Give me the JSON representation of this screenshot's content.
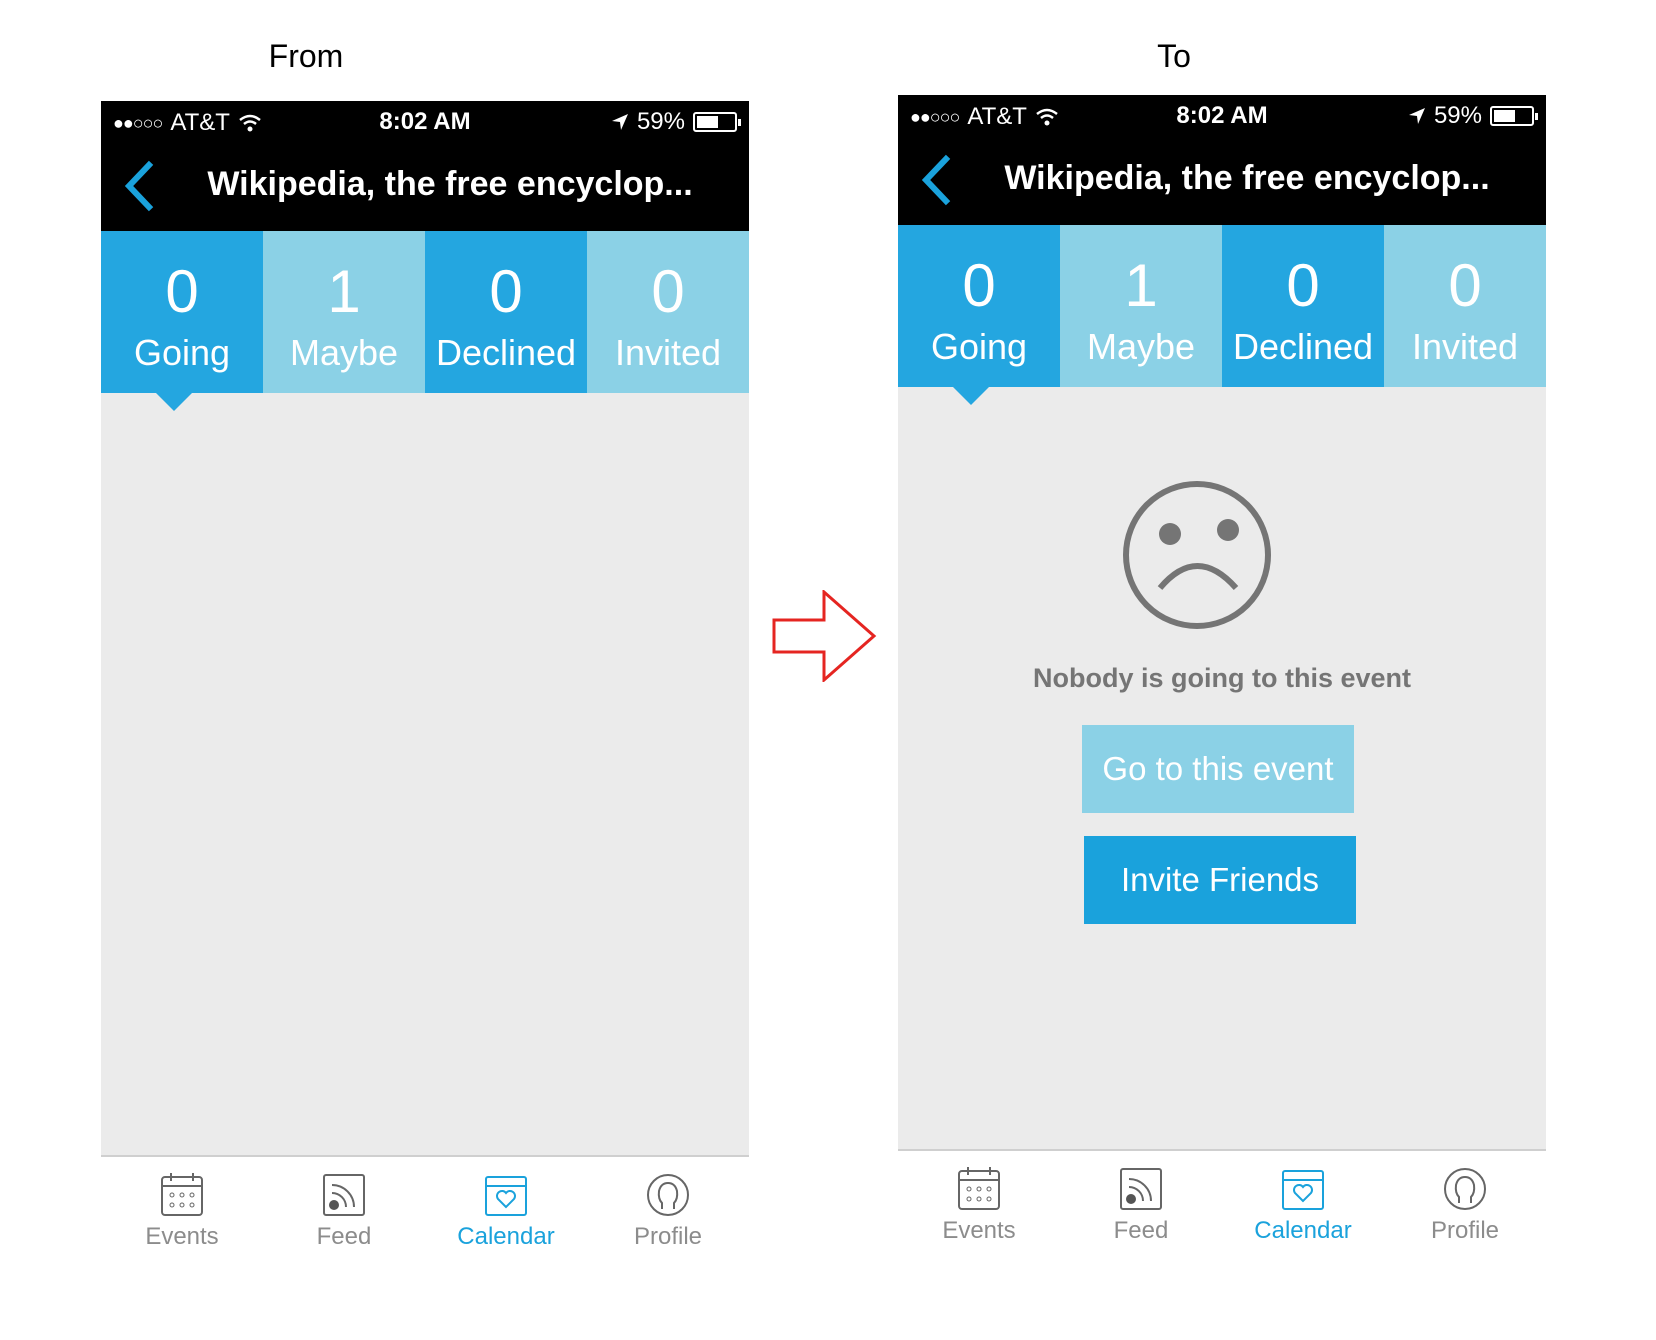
{
  "captions": {
    "from": "From",
    "to": "To"
  },
  "status": {
    "carrier": "AT&T",
    "time": "8:02 AM",
    "battery": "59%",
    "battery_level": 0.59
  },
  "navbar": {
    "title": "Wikipedia, the free encyclop..."
  },
  "tabs": [
    {
      "count": "0",
      "label": "Going",
      "style": "dark"
    },
    {
      "count": "1",
      "label": "Maybe",
      "style": "light"
    },
    {
      "count": "0",
      "label": "Declined",
      "style": "dark"
    },
    {
      "count": "0",
      "label": "Invited",
      "style": "light"
    }
  ],
  "empty_state": {
    "message": "Nobody is going to this event",
    "go_button": "Go to this event",
    "invite_button": "Invite Friends"
  },
  "tabbar": [
    {
      "label": "Events",
      "icon": "calendar-grid-icon",
      "active": false
    },
    {
      "label": "Feed",
      "icon": "feed-icon",
      "active": false
    },
    {
      "label": "Calendar",
      "icon": "calendar-heart-icon",
      "active": true
    },
    {
      "label": "Profile",
      "icon": "profile-icon",
      "active": false
    }
  ],
  "colors": {
    "tab_dark": "#24a6e0",
    "tab_light": "#8bd1e6",
    "active_blue": "#1aa2dc",
    "arrow_red": "#e52521"
  }
}
